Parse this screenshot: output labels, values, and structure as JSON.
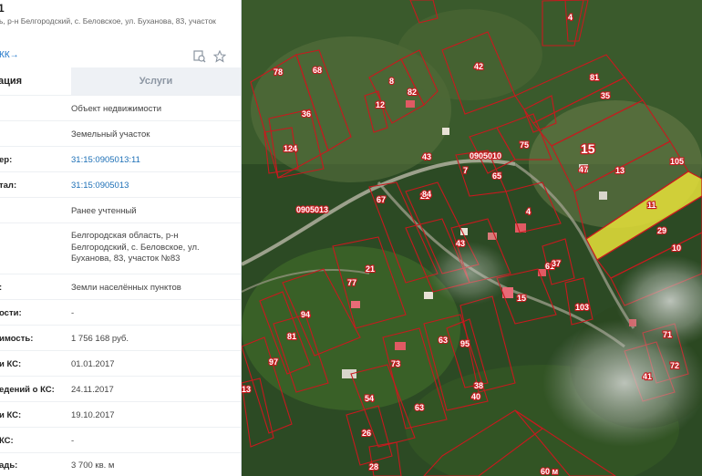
{
  "header": {
    "title": "1",
    "address": "ь, р-н Белгородский, с. Беловское, ул. Буханова, 83, участок",
    "kk_link": "КК→"
  },
  "tabs": [
    {
      "label": "ация"
    },
    {
      "label": "Услуги"
    }
  ],
  "rows": [
    {
      "label": "",
      "value": "Объект недвижимости"
    },
    {
      "label": "",
      "value": "Земельный участок"
    },
    {
      "label": "ер:",
      "value": "31:15:0905013:11"
    },
    {
      "label": "тал:",
      "value": "31:15:0905013"
    },
    {
      "label": "",
      "value": "Ранее учтенный"
    },
    {
      "label": "",
      "value": "Белгородская область, р-н Белгородский, с. Беловское, ул. Буханова, 83, участок №83"
    },
    {
      "label": ":",
      "value": "Земли населённых пунктов"
    },
    {
      "label": "ости:",
      "value": "-"
    },
    {
      "label": "имость:",
      "value": "1 756 168 руб."
    },
    {
      "label": "и КС:",
      "value": "01.01.2017"
    },
    {
      "label": "едений о КС:",
      "value": "24.11.2017"
    },
    {
      "label": "и КС:",
      "value": "19.10.2017"
    },
    {
      "label": "КС:",
      "value": "-"
    },
    {
      "label": "адь:",
      "value": "3 700 кв. м"
    }
  ],
  "map": {
    "labels": [
      "78",
      "68",
      "42",
      "36",
      "124",
      "8",
      "82",
      "12",
      "43",
      "81",
      "35",
      "15",
      "47",
      "13",
      "105",
      "11",
      "29",
      "10",
      "0905013",
      "0905010",
      "7",
      "65",
      "75",
      "21",
      "84",
      "67",
      "77",
      "21",
      "43",
      "4",
      "94",
      "81",
      "97",
      "103",
      "61",
      "63",
      "73",
      "71",
      "72",
      "41",
      "15",
      "37",
      "95",
      "54",
      "40",
      "38",
      "63",
      "26",
      "28",
      "60",
      "13",
      "4"
    ],
    "cadastral_block": "0905013",
    "block_number": "15",
    "selected_parcel": "11",
    "scale_text": "60 м"
  },
  "colors": {
    "parcel_border": "#c8191e",
    "selected_fill": "#e8e23a",
    "link": "#1c6fb6"
  }
}
